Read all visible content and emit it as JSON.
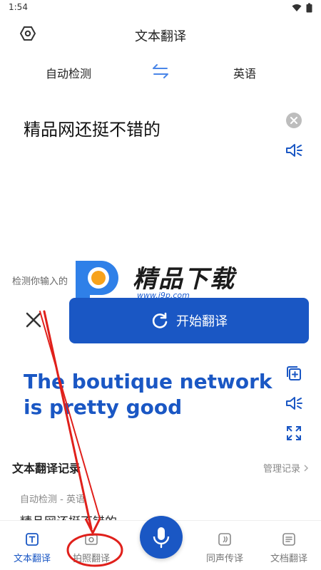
{
  "status": {
    "time": "1:54"
  },
  "header": {
    "title": "文本翻译",
    "settings_icon": "hexagon-settings-icon"
  },
  "languages": {
    "source": "自动检测",
    "target": "英语"
  },
  "input": {
    "text": "精品网还挺不错的"
  },
  "detect_hint": "检测你输入的",
  "watermark": {
    "brand": "精品下载",
    "url": "www.j9p.com"
  },
  "actions": {
    "translate_label": "开始翻译"
  },
  "result": {
    "text": "The boutique network is pretty good"
  },
  "history": {
    "title": "文本翻译记录",
    "manage_label": "管理记录",
    "items": [
      {
        "meta": "自动检测 - 英语",
        "text": "精品网还挺不错的"
      }
    ]
  },
  "nav": [
    {
      "label": "文本翻译",
      "icon": "text-translate-icon",
      "active": true
    },
    {
      "label": "拍照翻译",
      "icon": "photo-translate-icon",
      "active": false
    },
    {
      "label": "同声传译",
      "icon": "interpret-icon",
      "active": false
    },
    {
      "label": "文档翻译",
      "icon": "document-translate-icon",
      "active": false
    }
  ],
  "colors": {
    "accent": "#1a57c4",
    "annotation": "#e0201b"
  }
}
